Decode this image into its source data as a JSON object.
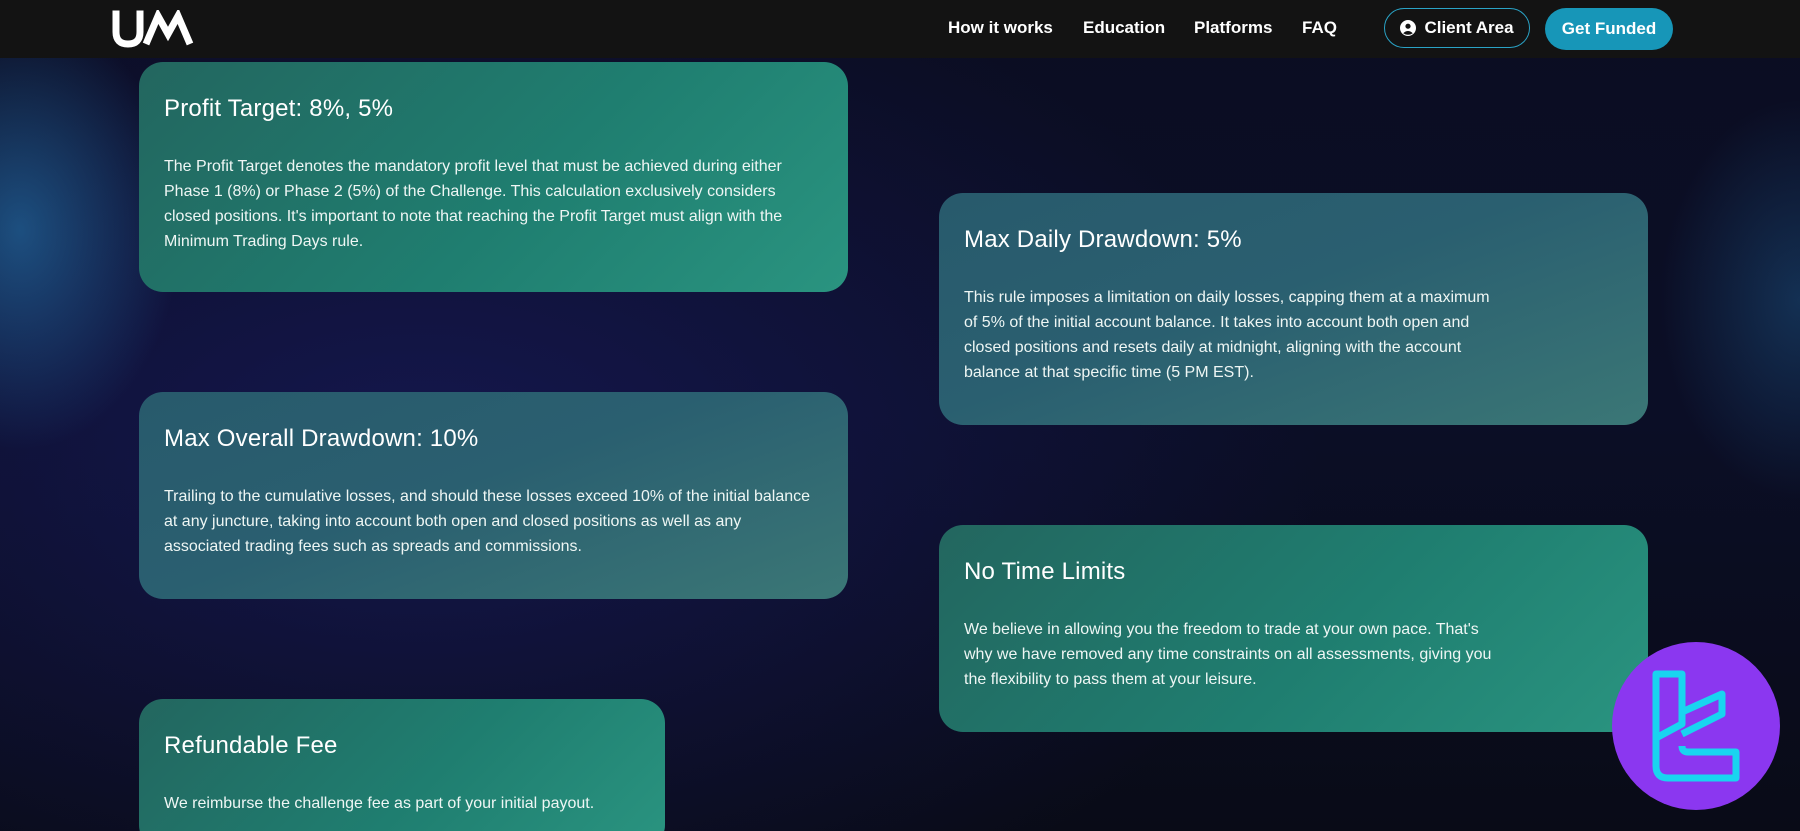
{
  "header": {
    "logo_text": "UM",
    "nav": [
      "How it works",
      "Education",
      "Platforms",
      "FAQ"
    ],
    "client_area_label": "Client Area",
    "get_funded_label": "Get Funded"
  },
  "cards": [
    {
      "title": "Profit Target: 8%, 5%",
      "body": "The Profit Target denotes the mandatory profit level that must be achieved during either Phase 1 (8%) or Phase 2 (5%) of the Challenge. This calculation exclusively considers closed positions. It's important to note that reaching the Profit Target must align with the Minimum Trading Days rule."
    },
    {
      "title": "Max Daily Drawdown: 5%",
      "body": "This rule imposes a limitation on daily losses, capping them at a maximum of 5% of the initial account balance. It takes into account both open and closed positions and resets daily at midnight, aligning with the account balance at that specific time (5 PM EST)."
    },
    {
      "title": "Max Overall Drawdown: 10%",
      "body": "Trailing to the cumulative losses, and should these losses exceed 10% of the initial balance at any juncture, taking into account both open and closed positions as well as any associated trading fees such as spreads and commissions."
    },
    {
      "title": "No Time Limits",
      "body": "We believe in allowing you the freedom to trade at your own pace. That's why we have removed any time constraints on all assessments, giving you the flexibility to pass them at your leisure."
    },
    {
      "title": "Refundable Fee",
      "body": "We reimburse the challenge fee as part of your initial payout."
    }
  ],
  "colors": {
    "header_bg": "#131313",
    "accent": "#1796b8",
    "card_green": "#1f7e70",
    "card_teal": "#2a5f70",
    "badge": "#8b37f0",
    "badge_glyph": "#19d4f0"
  },
  "icons": {
    "client_area": "user-circle-icon",
    "badge": "tc-logo-icon"
  }
}
